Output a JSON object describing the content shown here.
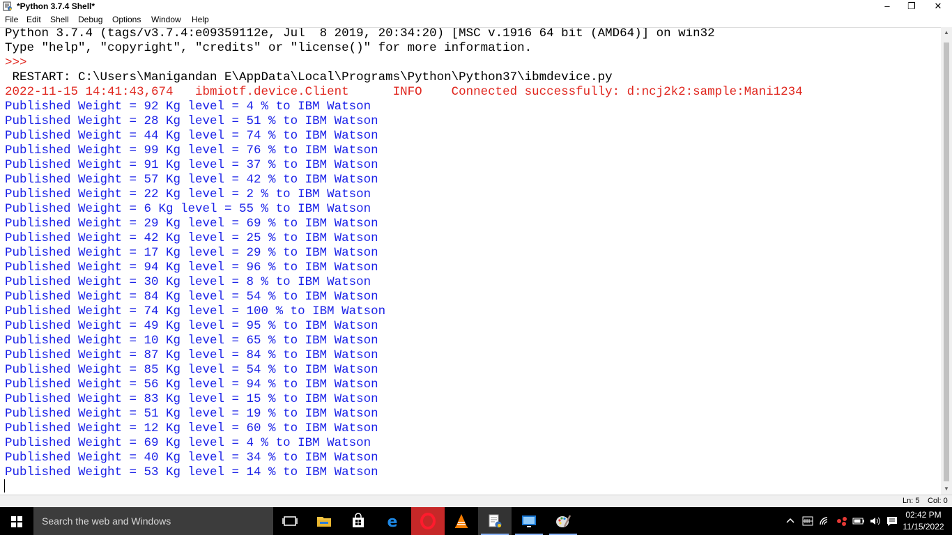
{
  "window": {
    "title": "*Python 3.7.4 Shell*",
    "controls": {
      "minimize": "–",
      "maximize": "❐",
      "close": "✕"
    }
  },
  "menu": [
    "File",
    "Edit",
    "Shell",
    "Debug",
    "Options",
    "Window",
    "Help"
  ],
  "shell_lines": [
    {
      "text": "Python 3.7.4 (tags/v3.7.4:e09359112e, Jul  8 2019, 20:34:20) [MSC v.1916 64 bit (AMD64)] on win32",
      "style": "black"
    },
    {
      "text": "Type \"help\", \"copyright\", \"credits\" or \"license()\" for more information.",
      "style": "black"
    },
    {
      "text": ">>> ",
      "style": "prompt"
    },
    {
      "text": " RESTART: C:\\Users\\Manigandan E\\AppData\\Local\\Programs\\Python\\Python37\\ibmdevice.py",
      "style": "black"
    },
    {
      "text": "2022-11-15 14:41:43,674   ibmiotf.device.Client      INFO    Connected successfully: d:ncj2k2:sample:Mani1234",
      "style": "red"
    },
    {
      "text": "Published Weight = 92 Kg level = 4 % to IBM Watson",
      "style": "blue"
    },
    {
      "text": "Published Weight = 28 Kg level = 51 % to IBM Watson",
      "style": "blue"
    },
    {
      "text": "Published Weight = 44 Kg level = 74 % to IBM Watson",
      "style": "blue"
    },
    {
      "text": "Published Weight = 99 Kg level = 76 % to IBM Watson",
      "style": "blue"
    },
    {
      "text": "Published Weight = 91 Kg level = 37 % to IBM Watson",
      "style": "blue"
    },
    {
      "text": "Published Weight = 57 Kg level = 42 % to IBM Watson",
      "style": "blue"
    },
    {
      "text": "Published Weight = 22 Kg level = 2 % to IBM Watson",
      "style": "blue"
    },
    {
      "text": "Published Weight = 6 Kg level = 55 % to IBM Watson",
      "style": "blue"
    },
    {
      "text": "Published Weight = 29 Kg level = 69 % to IBM Watson",
      "style": "blue"
    },
    {
      "text": "Published Weight = 42 Kg level = 25 % to IBM Watson",
      "style": "blue"
    },
    {
      "text": "Published Weight = 17 Kg level = 29 % to IBM Watson",
      "style": "blue"
    },
    {
      "text": "Published Weight = 94 Kg level = 96 % to IBM Watson",
      "style": "blue"
    },
    {
      "text": "Published Weight = 30 Kg level = 8 % to IBM Watson",
      "style": "blue"
    },
    {
      "text": "Published Weight = 84 Kg level = 54 % to IBM Watson",
      "style": "blue"
    },
    {
      "text": "Published Weight = 74 Kg level = 100 % to IBM Watson",
      "style": "blue"
    },
    {
      "text": "Published Weight = 49 Kg level = 95 % to IBM Watson",
      "style": "blue"
    },
    {
      "text": "Published Weight = 10 Kg level = 65 % to IBM Watson",
      "style": "blue"
    },
    {
      "text": "Published Weight = 87 Kg level = 84 % to IBM Watson",
      "style": "blue"
    },
    {
      "text": "Published Weight = 85 Kg level = 54 % to IBM Watson",
      "style": "blue"
    },
    {
      "text": "Published Weight = 56 Kg level = 94 % to IBM Watson",
      "style": "blue"
    },
    {
      "text": "Published Weight = 83 Kg level = 15 % to IBM Watson",
      "style": "blue"
    },
    {
      "text": "Published Weight = 51 Kg level = 19 % to IBM Watson",
      "style": "blue"
    },
    {
      "text": "Published Weight = 12 Kg level = 60 % to IBM Watson",
      "style": "blue"
    },
    {
      "text": "Published Weight = 69 Kg level = 4 % to IBM Watson",
      "style": "blue"
    },
    {
      "text": "Published Weight = 40 Kg level = 34 % to IBM Watson",
      "style": "blue"
    },
    {
      "text": "Published Weight = 53 Kg level = 14 % to IBM Watson",
      "style": "blue"
    }
  ],
  "status": {
    "line": "Ln: 5",
    "col": "Col: 0"
  },
  "taskbar": {
    "search_placeholder": "Search the web and Windows",
    "pinned": [
      "task-view-icon",
      "file-explorer-icon",
      "store-icon",
      "edge-icon",
      "opera-icon",
      "vlc-icon",
      "python-idle-icon",
      "remote-desktop-icon",
      "paint-icon"
    ],
    "tray_icons": [
      "chevron-up-icon",
      "keyboard-icon",
      "wifi-icon",
      "network-alert-icon",
      "battery-icon",
      "volume-icon",
      "notification-icon"
    ],
    "clock_time": "02:42 PM",
    "clock_date": "11/15/2022"
  },
  "colors": {
    "stdout_black": "#000000",
    "stderr_red": "#e0271f",
    "output_blue": "#1b22e8",
    "taskbar_bg": "#000000"
  }
}
